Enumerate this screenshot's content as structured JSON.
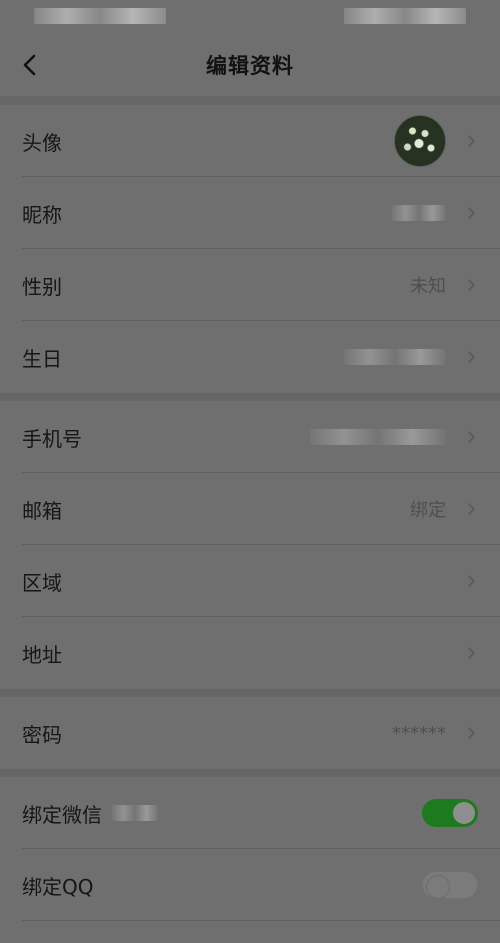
{
  "header": {
    "title": "编辑资料"
  },
  "sections": [
    {
      "items": [
        {
          "label": "头像",
          "type": "avatar"
        },
        {
          "label": "昵称",
          "type": "blur"
        },
        {
          "label": "性别",
          "type": "text",
          "value": "未知"
        },
        {
          "label": "生日",
          "type": "blur"
        }
      ]
    },
    {
      "items": [
        {
          "label": "手机号",
          "type": "blur"
        },
        {
          "label": "邮箱",
          "type": "text",
          "value": "绑定"
        },
        {
          "label": "区域",
          "type": "empty"
        },
        {
          "label": "地址",
          "type": "empty"
        }
      ]
    },
    {
      "items": [
        {
          "label": "密码",
          "type": "text",
          "value": "******"
        }
      ]
    },
    {
      "items": [
        {
          "label": "绑定微信",
          "type": "toggle-on",
          "extra_blur": true
        },
        {
          "label": "绑定QQ",
          "type": "toggle-off"
        }
      ]
    }
  ]
}
